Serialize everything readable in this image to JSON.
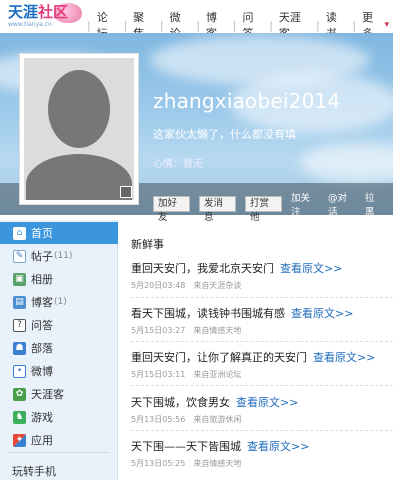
{
  "logo": {
    "main_a": "天涯",
    "main_b": "社区",
    "sub": "www.tianya.cn"
  },
  "nav": {
    "items": [
      "论坛",
      "聚焦",
      "微论",
      "博客",
      "问答",
      "天涯客",
      "读书"
    ],
    "more": "更多"
  },
  "profile": {
    "username": "zhangxiaobei2014",
    "signature": "这家伙太懒了，什么都没有填",
    "mood": "心情：暂无"
  },
  "actions": {
    "add_friend": "加好友",
    "message": "发消息",
    "tip": "打赏他",
    "follow": "加关注",
    "at_chat": "@对话",
    "block": "拉黑"
  },
  "sidebar": {
    "items": [
      {
        "label": "首页",
        "count": "",
        "icon": "home-icon"
      },
      {
        "label": "帖子",
        "count": "(11)",
        "icon": "post-icon"
      },
      {
        "label": "相册",
        "count": "",
        "icon": "album-icon"
      },
      {
        "label": "博客",
        "count": "(1)",
        "icon": "blog-icon"
      },
      {
        "label": "问答",
        "count": "",
        "icon": "qa-icon"
      },
      {
        "label": "部落",
        "count": "",
        "icon": "tribe-icon"
      },
      {
        "label": "微博",
        "count": "",
        "icon": "weibo-icon"
      },
      {
        "label": "天涯客",
        "count": "",
        "icon": "tianyake-icon"
      },
      {
        "label": "游戏",
        "count": "",
        "icon": "game-icon"
      },
      {
        "label": "应用",
        "count": "",
        "icon": "app-icon"
      }
    ],
    "footer": "玩转手机"
  },
  "feed": {
    "title": "新鲜事",
    "items": [
      {
        "text": "重回天安门，我爱北京天安门",
        "link": "查看原文>>",
        "date": "5月20日03:48",
        "source": "来自天涯杂谈"
      },
      {
        "text": "看天下围城，读钱钟书围城有感",
        "link": "查看原文>>",
        "date": "5月15日03:27",
        "source": "来自情感天地"
      },
      {
        "text": "重回天安门，让你了解真正的天安门",
        "link": "查看原文>>",
        "date": "5月15日03:11",
        "source": "来自亚洲论坛"
      },
      {
        "text": "天下围城，饮食男女",
        "link": "查看原文>>",
        "date": "5月13日05:56",
        "source": "来自旅游休闲"
      },
      {
        "text": "天下围——天下皆围城",
        "link": "查看原文>>",
        "date": "5月13日05:25",
        "source": "来自情感天地"
      }
    ]
  },
  "colors": {
    "accent": "#3c96de",
    "link": "#1f6bbd",
    "brand_pink": "#e23d7c",
    "brand_blue": "#1b6fc1"
  }
}
